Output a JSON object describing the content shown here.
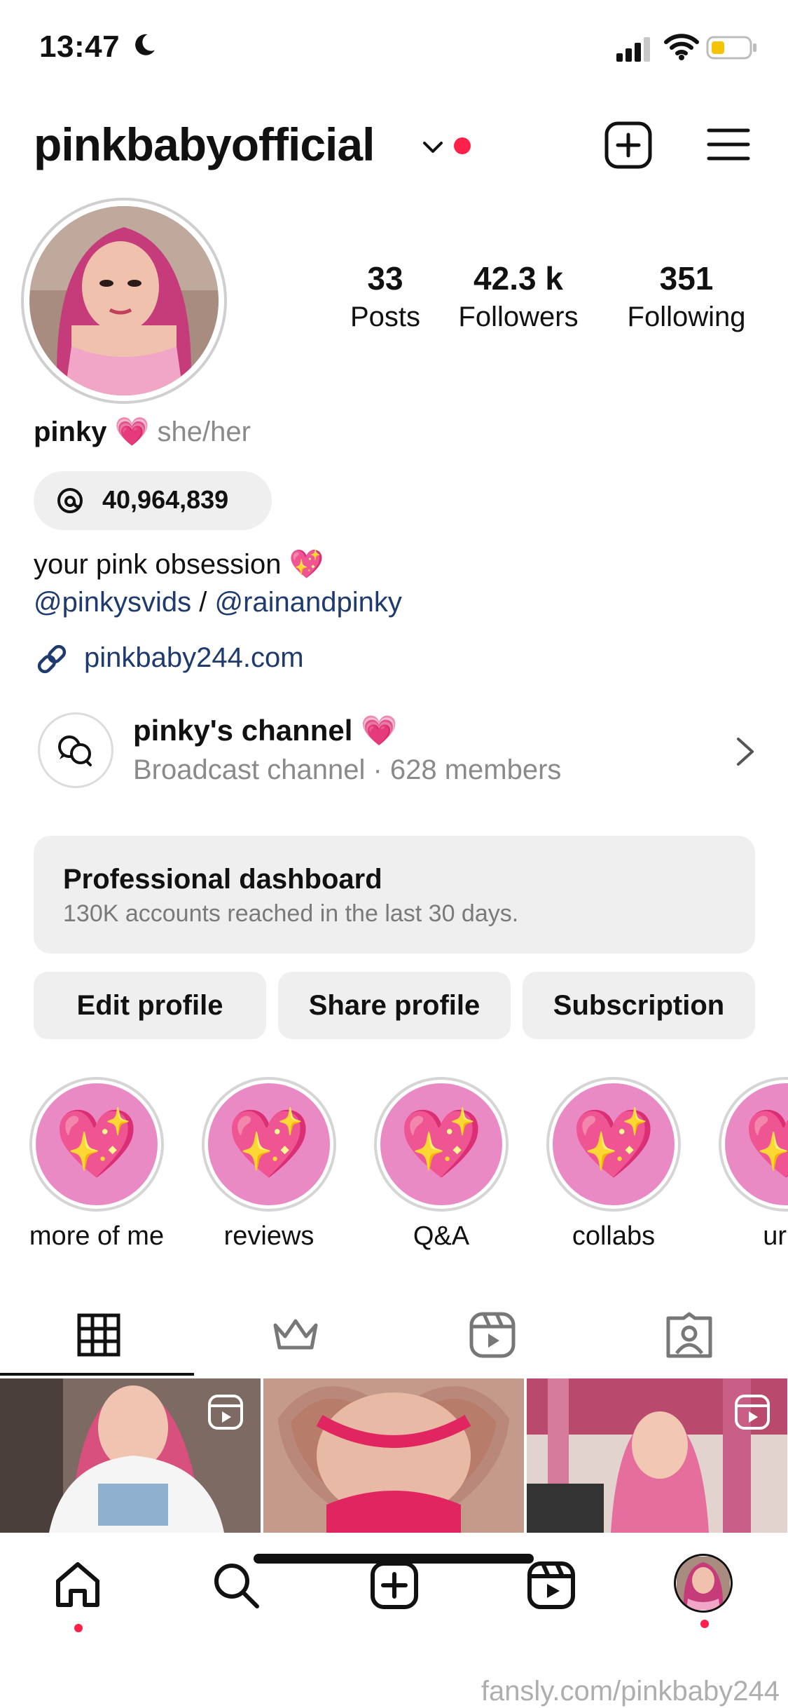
{
  "status_bar": {
    "time": "13:47"
  },
  "header": {
    "username": "pinkbabyofficial"
  },
  "stats": [
    {
      "value": "33",
      "label": "Posts"
    },
    {
      "value": "42.3 k",
      "label": "Followers"
    },
    {
      "value": "351",
      "label": "Following"
    }
  ],
  "profile": {
    "name": "pinky",
    "name_emoji": "💗",
    "pronouns": "she/her",
    "threads_count": "40,964,839",
    "bio_line": "your pink obsession 💖",
    "mention_1": "@pinkysvids",
    "mention_sep": " / ",
    "mention_2": "@rainandpinky",
    "link": "pinkbaby244.com"
  },
  "channel": {
    "title": "pinky's channel 💗",
    "subtitle": "Broadcast channel · 628 members"
  },
  "dashboard": {
    "title": "Professional dashboard",
    "subtitle": "130K accounts reached in the last 30 days."
  },
  "buttons": {
    "edit": "Edit profile",
    "share": "Share profile",
    "subscription": "Subscription"
  },
  "highlights": [
    {
      "label": "more of me",
      "emoji": "💖"
    },
    {
      "label": "reviews",
      "emoji": "💖"
    },
    {
      "label": "Q&A",
      "emoji": "💖"
    },
    {
      "label": "collabs",
      "emoji": "💖"
    },
    {
      "label": "ur a",
      "emoji": "💖"
    }
  ],
  "watermark": "fansly.com/pinkbaby244",
  "colors": {
    "accent_red": "#ff1f4b",
    "link_blue": "#1e3a6e",
    "highlight_pink": "#ea8ac5"
  }
}
